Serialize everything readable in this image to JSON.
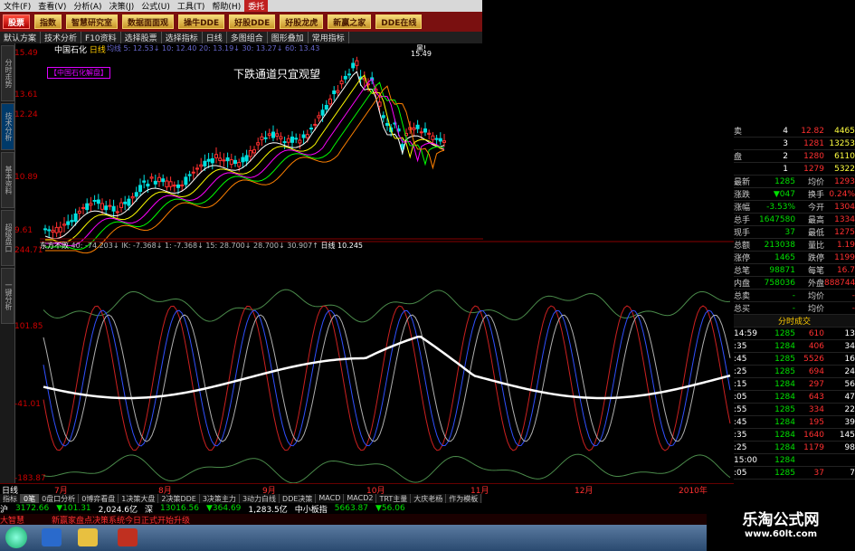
{
  "menubar": [
    "文件(F)",
    "查看(V)",
    "分析(A)",
    "决策(J)",
    "公式(U)",
    "工具(T)",
    "帮助(H)",
    "委托"
  ],
  "toolbar": [
    "股票",
    "指数",
    "智慧研究室",
    "数据面面观",
    "操牛DDE",
    "好股DDE",
    "好股龙虎",
    "新赢之家",
    "DDE在线"
  ],
  "tabbar": [
    "默认方案",
    "技术分析",
    "F10资料",
    "选择股票",
    "选择指标",
    "日线",
    "多图组合",
    "图形叠加",
    "常用指标"
  ],
  "left_tabs": [
    "分时走势",
    "技术分析",
    "基本资料",
    "超级盘口",
    "一键分析"
  ],
  "chart": {
    "stock_name": "中国石化",
    "period": "日线",
    "info_text": "均线 5: 12.53↓ 10: 12.40 20: 13.19↓ 30: 13.27↓ 60: 13.43",
    "black_tag": "黑!",
    "brand_tag": "【中国石化解盘】",
    "annotation": "下跌通道只宜观望",
    "price_axis": [
      "15.49",
      "13.61",
      "12.24",
      "10.89",
      "9.61"
    ],
    "peak_label": "15.49",
    "indicator_name": "东方不败",
    "indicator_values": "40: -74.203↓   IK: -7.368↓   1: -7.368↓   15: 28.700↓   28.700↓   30.907↑",
    "indicator_flag": "日线",
    "indicator_value2": "10.245",
    "indicator_axis": [
      "244.71",
      "101.85",
      "-41.01",
      "-183.87"
    ],
    "date_labels": [
      "7月",
      "8月",
      "9月",
      "10月",
      "11月",
      "12月",
      "2010年"
    ]
  },
  "quote_panel": {
    "ask_rows": [
      {
        "label": "卖",
        "n": "4",
        "price": "12.82",
        "vol": "4465"
      },
      {
        "label": "",
        "n": "3",
        "price": "1281",
        "vol": "13253"
      },
      {
        "label": "盘",
        "n": "2",
        "price": "1280",
        "vol": "6110"
      },
      {
        "label": "",
        "n": "1",
        "price": "1279",
        "vol": "5322"
      }
    ],
    "stats": [
      {
        "k1": "最新",
        "v1": "1285",
        "k2": "均价",
        "v2": "1293"
      },
      {
        "k1": "涨跌",
        "v1": "▼047",
        "k2": "换手",
        "v2": "0.24%"
      },
      {
        "k1": "涨幅",
        "v1": "-3.53%",
        "k2": "今开",
        "v2": "1304"
      },
      {
        "k1": "总手",
        "v1": "1647580",
        "k2": "最高",
        "v2": "1334"
      },
      {
        "k1": "现手",
        "v1": "37",
        "k2": "最低",
        "v2": "1275"
      },
      {
        "k1": "总额",
        "v1": "213038",
        "k2": "量比",
        "v2": "1.19"
      },
      {
        "k1": "涨停",
        "v1": "1465",
        "k2": "跌停",
        "v2": "1199"
      },
      {
        "k1": "总笔",
        "v1": "98871",
        "k2": "每笔",
        "v2": "16.7"
      },
      {
        "k1": "内盘",
        "v1": "758036",
        "k2": "外盘",
        "v2": "888744"
      },
      {
        "k1": "总卖",
        "v1": "-",
        "k2": "均价",
        "v2": "-"
      },
      {
        "k1": "总买",
        "v1": "-",
        "k2": "均价",
        "v2": "-"
      }
    ],
    "ticks_title": "分时成交",
    "ticks": [
      {
        "t": "14:59",
        "p": "1285",
        "v": "610",
        "d": "13"
      },
      {
        "t": ":35",
        "p": "1284",
        "v": "406",
        "d": "34"
      },
      {
        "t": ":45",
        "p": "1285",
        "v": "5526",
        "d": "16"
      },
      {
        "t": ":25",
        "p": "1285",
        "v": "694",
        "d": "24"
      },
      {
        "t": ":15",
        "p": "1284",
        "v": "297",
        "d": "56"
      },
      {
        "t": ":05",
        "p": "1284",
        "v": "643",
        "d": "47"
      },
      {
        "t": ":55",
        "p": "1285",
        "v": "334",
        "d": "22"
      },
      {
        "t": ":45",
        "p": "1284",
        "v": "195",
        "d": "39"
      },
      {
        "t": ":35",
        "p": "1284",
        "v": "1640",
        "d": "145"
      },
      {
        "t": ":25",
        "p": "1284",
        "v": "1179",
        "d": "98"
      },
      {
        "t": "15:00",
        "p": "1284",
        "v": "",
        "d": ""
      },
      {
        "t": ":05",
        "p": "1285",
        "v": "37",
        "d": "7"
      }
    ]
  },
  "day_line_label": "日线",
  "bottom_tabs": [
    "指标",
    "0笔",
    "0盘口分析",
    "0博弈看盘",
    "1决策大盘",
    "2决策DDE",
    "3决策主力",
    "3动力白线",
    "DDE决策",
    "MACD",
    "MACD2",
    "TRT主量",
    "大庆老杨",
    "作为模板"
  ],
  "statusbar": {
    "label": "沪",
    "idx1": "3172.66",
    "chg1": "▼101.31",
    "amt1": "2,024.6亿",
    "mkt2": "深",
    "idx2": "13016.56",
    "chg2": "▼364.69",
    "amt2": "1,283.5亿",
    "mkt3": "中小板指",
    "idx3": "5663.87",
    "chg3": "▼56.06"
  },
  "newsbar": {
    "tag": "大智慧",
    "text": "新赢家盘点决策系统今日正式开始升级"
  },
  "watermark": {
    "line1": "乐淘公式网",
    "line2": "www.60lt.com"
  },
  "colors": {
    "toolbar": "#7a1010",
    "up": "#ff3030",
    "down": "#00e000",
    "axis": "#cc0000"
  }
}
